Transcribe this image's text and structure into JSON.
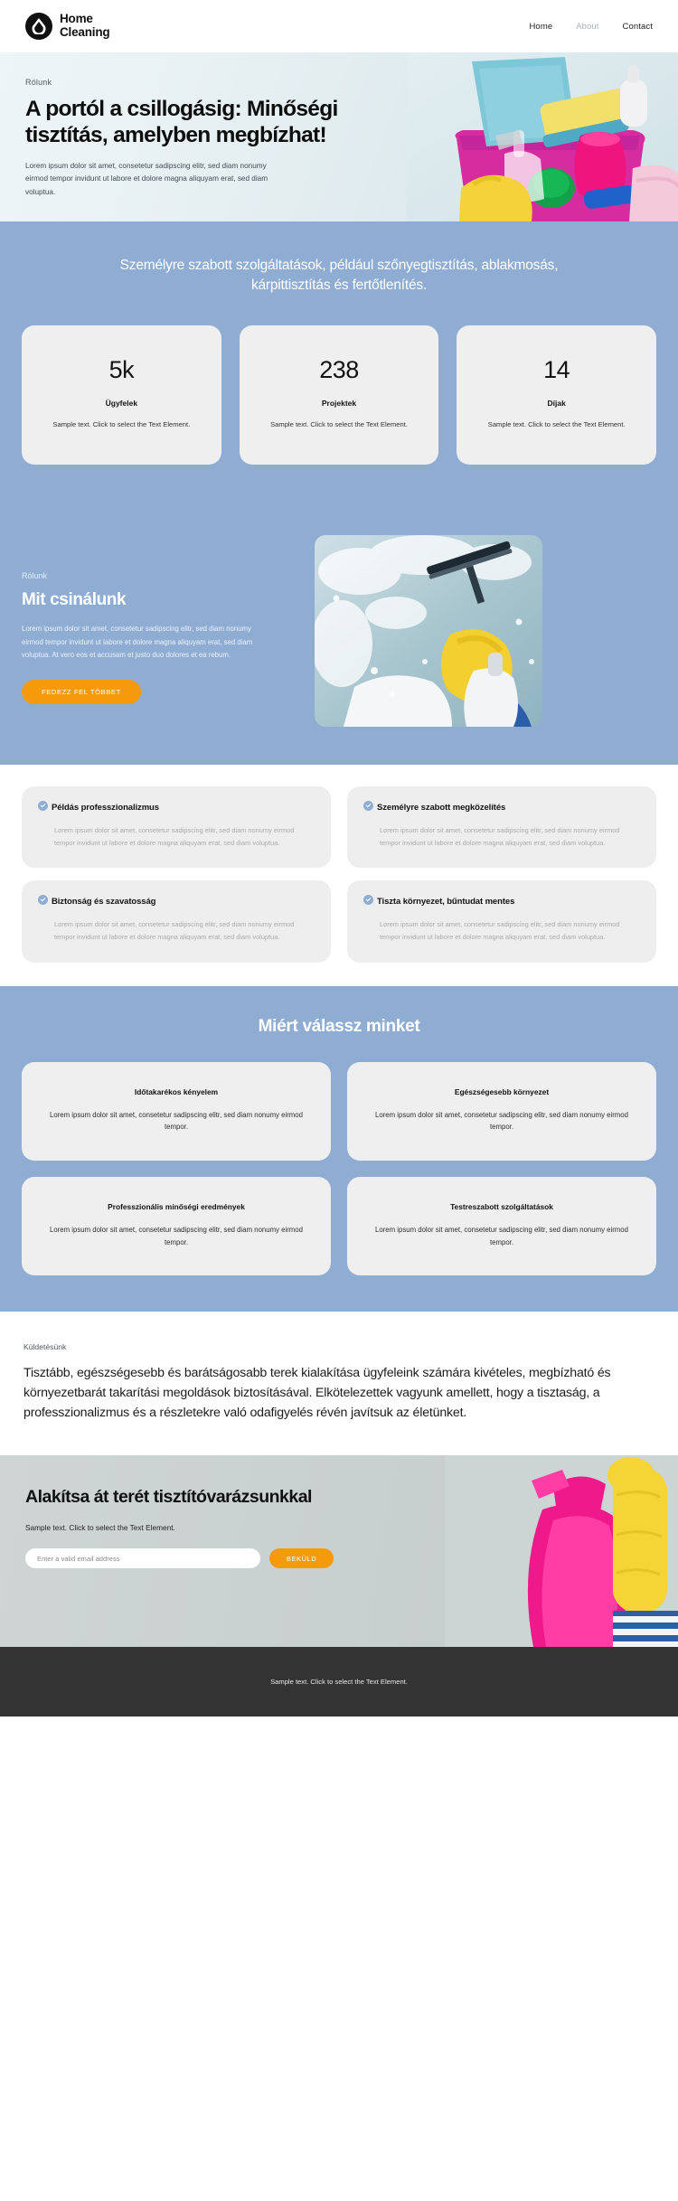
{
  "header": {
    "brand_line1": "Home",
    "brand_line2": "Cleaning",
    "logo_icon": "water-drop-in-circle-icon",
    "nav": [
      {
        "label": "Home",
        "muted": false
      },
      {
        "label": "About",
        "muted": true
      },
      {
        "label": "Contact",
        "muted": false
      }
    ]
  },
  "hero": {
    "eyebrow": "Rólunk",
    "heading": "A portól a csillogásig: Minőségi tisztítás, amelyben megbízhat!",
    "paragraph": "Lorem ipsum dolor sit amet, consetetur sadipscing elitr, sed diam nonumy eirmod tempor invidunt ut labore et dolore magna aliquyam erat, sed diam voluptua."
  },
  "stats_section": {
    "lead": "Személyre szabott szolgáltatások, például szőnyegtisztítás, ablakmosás, kárpittisztítás és fertőtlenítés.",
    "cards": [
      {
        "number": "5k",
        "label": "Ügyfelek",
        "desc": "Sample text. Click to select the Text Element."
      },
      {
        "number": "238",
        "label": "Projektek",
        "desc": "Sample text. Click to select the Text Element."
      },
      {
        "number": "14",
        "label": "Díjak",
        "desc": "Sample text. Click to select the Text Element."
      }
    ]
  },
  "about": {
    "eyebrow": "Rólunk",
    "heading": "Mit csinálunk",
    "paragraph": "Lorem ipsum dolor sit amet, consetetur sadipscing elitr, sed diam nonumy eirmod tempor invidunt ut labore et dolore magna aliquyam erat, sed diam voluptua. At vero eos et accusam et justo duo dolores et ea rebum.",
    "button": "FEDEZZ FEL TÖBBET",
    "image_alt": "window-cleaning-photo"
  },
  "features": {
    "body_text": "Lorem ipsum dolor sit amet, consetetur sadipscing elitr, sed diam nonumy eirmod tempor invidunt ut labore et dolore magna aliquyam erat, sed diam voluptua.",
    "left": [
      {
        "title": "Példás professzionalizmus"
      },
      {
        "title": "Biztonság és szavatosság"
      }
    ],
    "right": [
      {
        "title": "Személyre szabott megközelítés"
      },
      {
        "title": "Tiszta környezet, bűntudat mentes"
      }
    ]
  },
  "why": {
    "heading": "Miért válassz minket",
    "body_text": "Lorem ipsum dolor sit amet, consetetur sadipscing elitr, sed diam nonumy eirmod tempor.",
    "cards": [
      {
        "title": "Időtakarékos kényelem"
      },
      {
        "title": "Egészségesebb környezet"
      },
      {
        "title": "Professzionális minőségi eredmények"
      },
      {
        "title": "Testreszabott szolgáltatások"
      }
    ]
  },
  "mission": {
    "eyebrow": "Küldetésünk",
    "text": "Tisztább, egészségesebb és barátságosabb terek kialakítása ügyfeleink számára kivételes, megbízható és környezetbarát takarítási megoldások biztosításával. Elkötelezettek vagyunk amellett, hogy a tisztaság, a professzionalizmus és a részletekre való odafigyelés révén javítsuk az életünket."
  },
  "cta": {
    "heading": "Alakítsa át terét tisztítóvarázsunkkal",
    "sub": "Sample text. Click to select the Text Element.",
    "email_placeholder": "Enter a valid email address",
    "button": "BEKÜLD",
    "image_alt": "gloved-hand-with-spray-bottle"
  },
  "footer": {
    "text": "Sample text. Click to select the Text Element."
  },
  "colors": {
    "blue": "#8fadd3",
    "orange": "#f59b0b",
    "card": "#efefef",
    "footer": "#333333"
  }
}
